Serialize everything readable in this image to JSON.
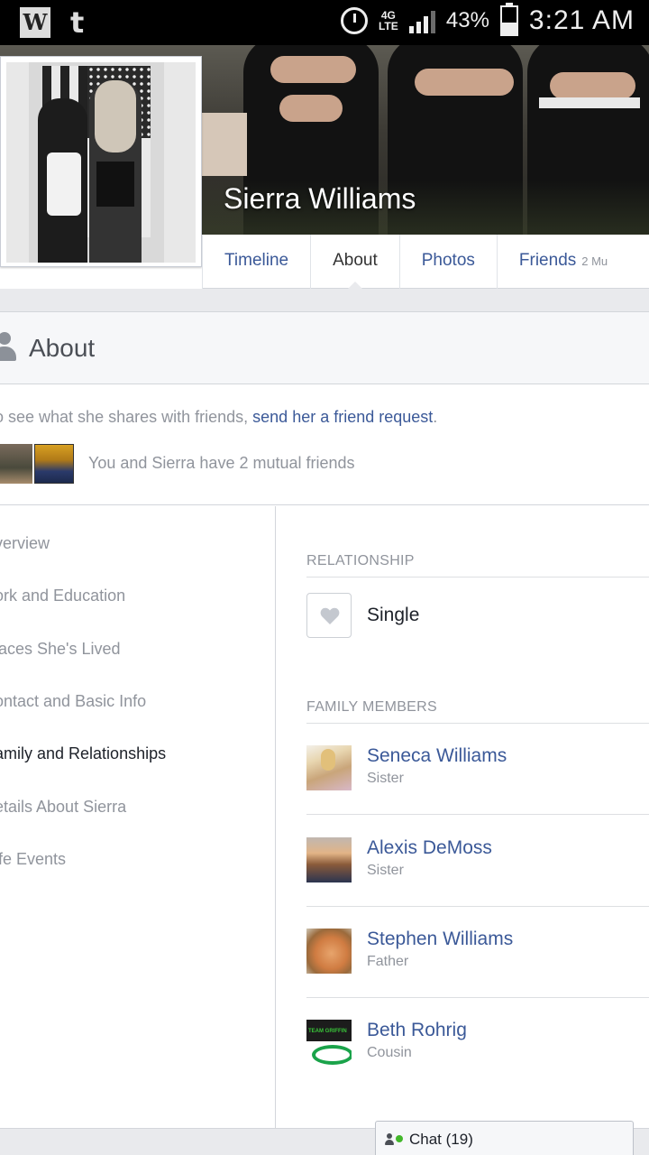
{
  "status_bar": {
    "left_icons": [
      "w-app-icon",
      "tumblr-icon"
    ],
    "w_letter": "W",
    "t_letter": "t",
    "network_type": "4G LTE",
    "battery_percent": "43%",
    "battery_level": 0.43,
    "time": "3:21 AM"
  },
  "profile": {
    "name": "Sierra Williams"
  },
  "tabs": [
    {
      "label": "Timeline"
    },
    {
      "label": "About"
    },
    {
      "label": "Photos"
    },
    {
      "label": "Friends",
      "count": "2 Mu"
    }
  ],
  "about": {
    "title": "About",
    "intro_prefix": "o see what she shares with friends, ",
    "intro_link": "send her a friend request",
    "intro_suffix": ".",
    "mutual_text": "You and Sierra have 2 mutual friends"
  },
  "left_nav": [
    {
      "label": "verview",
      "active": false
    },
    {
      "label": "ork and Education",
      "active": false
    },
    {
      "label": "laces She's Lived",
      "active": false
    },
    {
      "label": "ontact and Basic Info",
      "active": false
    },
    {
      "label": "amily and Relationships",
      "active": true
    },
    {
      "label": "etails About Sierra",
      "active": false
    },
    {
      "label": "ife Events",
      "active": false
    }
  ],
  "relationship": {
    "section_title": "RELATIONSHIP",
    "status": "Single"
  },
  "family": {
    "section_title": "FAMILY MEMBERS",
    "members": [
      {
        "name": "Seneca Williams",
        "relation": "Sister"
      },
      {
        "name": "Alexis DeMoss",
        "relation": "Sister"
      },
      {
        "name": "Stephen Williams",
        "relation": "Father"
      },
      {
        "name": "Beth Rohrig",
        "relation": "Cousin",
        "thumb_text": "TEAM GRIFFIN"
      }
    ]
  },
  "chat": {
    "label": "Chat (19)"
  },
  "colors": {
    "link": "#3b5998",
    "muted": "#90949c",
    "online": "#42b72a"
  }
}
